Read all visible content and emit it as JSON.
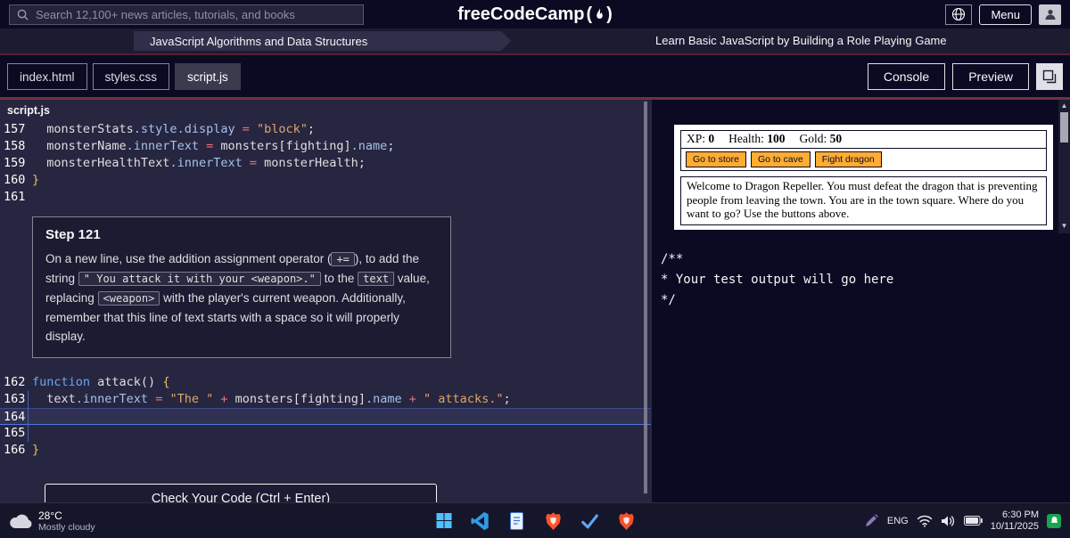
{
  "topbar": {
    "search_placeholder": "Search 12,100+ news articles, tutorials, and books",
    "logo": "freeCodeCamp",
    "logo_open": "(",
    "logo_close": ")",
    "menu": "Menu"
  },
  "breadcrumb": {
    "course": "JavaScript Algorithms and Data Structures",
    "challenge": "Learn Basic JavaScript by Building a Role Playing Game"
  },
  "tabs": {
    "files": [
      {
        "label": "index.html"
      },
      {
        "label": "styles.css"
      },
      {
        "label": "script.js"
      }
    ],
    "console": "Console",
    "preview": "Preview"
  },
  "editor": {
    "filename": "script.js",
    "code_top": [
      {
        "n": "157",
        "tokens": [
          [
            "pl",
            "  monsterStats"
          ],
          [
            "pr",
            ".style.display"
          ],
          [
            "pl",
            " "
          ],
          [
            "op",
            "="
          ],
          [
            "pl",
            " "
          ],
          [
            "st",
            "\"block\""
          ],
          [
            "pl",
            ";"
          ]
        ]
      },
      {
        "n": "158",
        "tokens": [
          [
            "pl",
            "  monsterName"
          ],
          [
            "pr",
            ".innerText"
          ],
          [
            "pl",
            " "
          ],
          [
            "op",
            "="
          ],
          [
            "pl",
            " monsters[fighting]"
          ],
          [
            "pr",
            ".name"
          ],
          [
            "pl",
            ";"
          ]
        ]
      },
      {
        "n": "159",
        "tokens": [
          [
            "pl",
            "  monsterHealthText"
          ],
          [
            "pr",
            ".innerText"
          ],
          [
            "pl",
            " "
          ],
          [
            "op",
            "="
          ],
          [
            "pl",
            " monsterHealth;"
          ]
        ]
      },
      {
        "n": "160",
        "tokens": [
          [
            "br",
            "}"
          ]
        ]
      },
      {
        "n": "161",
        "tokens": []
      }
    ],
    "step": {
      "title": "Step 121",
      "body": [
        [
          "t",
          "On a new line, use the addition assignment operator ("
        ],
        [
          "c",
          "+="
        ],
        [
          "t",
          "), to add the string "
        ],
        [
          "c",
          "\" You attack it with your <weapon>.\""
        ],
        [
          "t",
          " to the "
        ],
        [
          "c",
          "text"
        ],
        [
          "t",
          " value, replacing "
        ],
        [
          "c",
          "<weapon>"
        ],
        [
          "t",
          " with the player's current weapon. Additionally, remember that this line of text starts with a space so it will properly display."
        ]
      ]
    },
    "code_bottom": [
      {
        "n": "162",
        "tokens": [
          [
            "kw",
            "function"
          ],
          [
            "pl",
            " attack() "
          ],
          [
            "br",
            "{"
          ]
        ]
      },
      {
        "n": "163",
        "tokens": [
          [
            "pl",
            "  text"
          ],
          [
            "pr",
            ".innerText"
          ],
          [
            "pl",
            " "
          ],
          [
            "op",
            "="
          ],
          [
            "pl",
            " "
          ],
          [
            "st",
            "\"The \""
          ],
          [
            "pl",
            " "
          ],
          [
            "op",
            "+"
          ],
          [
            "pl",
            " monsters[fighting]"
          ],
          [
            "pr",
            ".name"
          ],
          [
            "pl",
            " "
          ],
          [
            "op",
            "+"
          ],
          [
            "pl",
            " "
          ],
          [
            "st",
            "\" attacks.\""
          ],
          [
            "pl",
            ";"
          ]
        ]
      },
      {
        "n": "164",
        "tokens": [],
        "current": true
      },
      {
        "n": "165",
        "tokens": []
      },
      {
        "n": "166",
        "tokens": [
          [
            "br",
            "}"
          ]
        ]
      }
    ],
    "check_button": "Check Your Code (Ctrl + Enter)"
  },
  "preview": {
    "stats": [
      {
        "label": "XP:",
        "value": "0"
      },
      {
        "label": "Health:",
        "value": "100"
      },
      {
        "label": "Gold:",
        "value": "50"
      }
    ],
    "buttons": [
      "Go to store",
      "Go to cave",
      "Fight dragon"
    ],
    "text": "Welcome to Dragon Repeller. You must defeat the dragon that is preventing people from leaving the town. You are in the town square. Where do you want to go? Use the buttons above."
  },
  "console": {
    "lines": [
      "/**",
      "* Your test output will go here",
      "*/"
    ]
  },
  "taskbar": {
    "weather": {
      "temp": "28°C",
      "desc": "Mostly cloudy"
    },
    "language": "ENG",
    "time": "6:30 PM",
    "date": "10/11/2025"
  },
  "icons": {
    "scroll_up": "▲",
    "scroll_down": "▼"
  },
  "colors": {
    "accent_gold": "#feac32",
    "fcc_dark": "#0a0a23",
    "panel_dark": "#1b1b32",
    "editor_bg": "#2a2a40",
    "separator_red": "#76303a"
  }
}
